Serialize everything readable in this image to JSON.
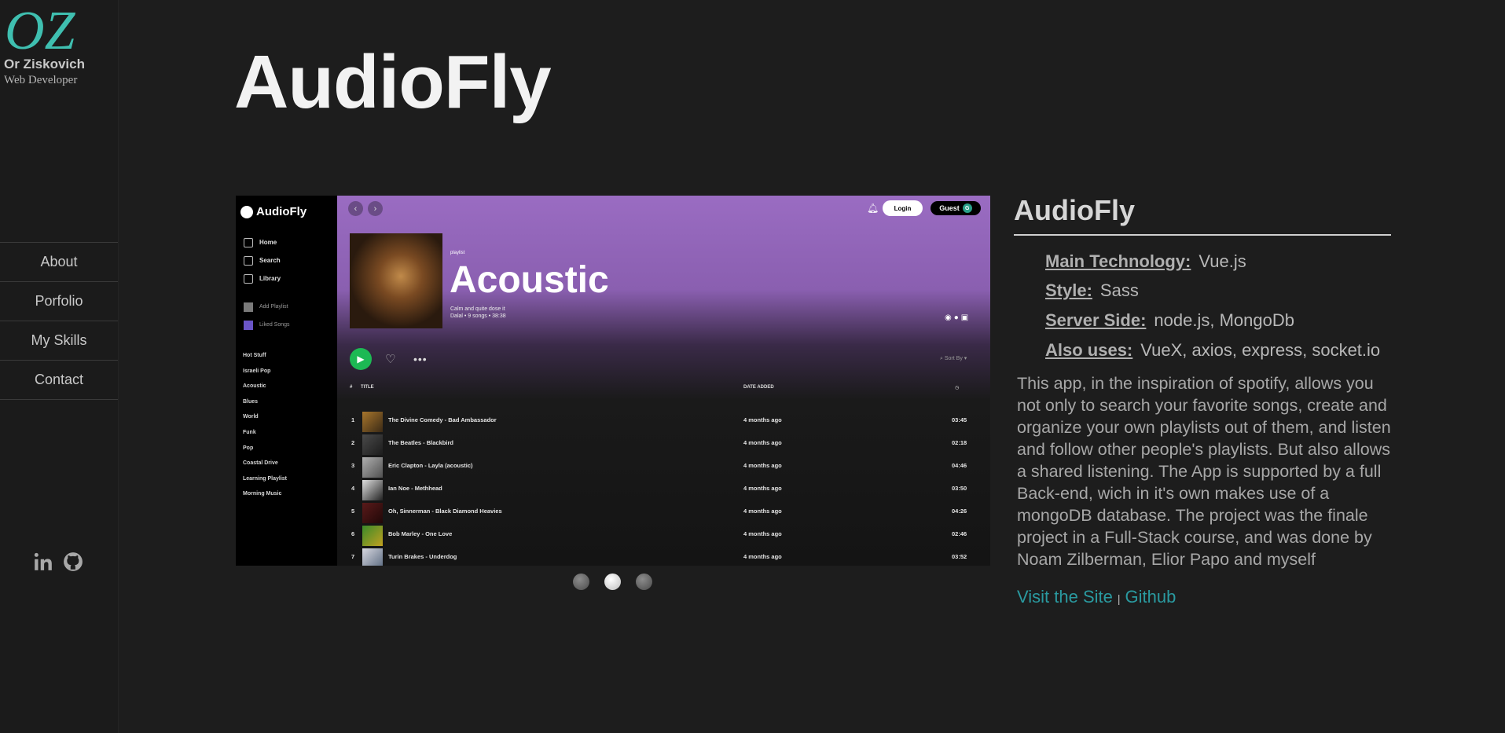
{
  "sidebar": {
    "logo_text": "OZ",
    "name": "Or Ziskovich",
    "role": "Web Developer",
    "nav": [
      {
        "label": "About"
      },
      {
        "label": "Porfolio"
      },
      {
        "label": "My Skills"
      },
      {
        "label": "Contact"
      }
    ],
    "socials": [
      {
        "icon": "linkedin-icon"
      },
      {
        "icon": "github-icon"
      }
    ]
  },
  "main": {
    "title": "AudioFly",
    "carousel": {
      "slide_count": 3,
      "active_index": 1,
      "screenshot": {
        "brand": "AudioFly",
        "nav": [
          "Home",
          "Search",
          "Library"
        ],
        "actions": [
          "Add Playlist",
          "Liked Songs"
        ],
        "playlists": [
          "Hot Stuff",
          "Israeli Pop",
          "Acoustic",
          "Blues",
          "World",
          "Funk",
          "Pop",
          "Coastal Drive",
          "Learning Playlist",
          "Morning Music"
        ],
        "login_label": "Login",
        "guest_label": "Guest",
        "guest_initial": "G",
        "playlist_kind": "playlist",
        "playlist_name": "Acoustic",
        "playlist_desc": "Calm and quite dose it",
        "playlist_meta": "Dalal  •  9 songs  •  38:38",
        "sort_label": "Sort By",
        "col_num": "#",
        "col_title": "TITLE",
        "col_date": "DATE ADDED",
        "songs": [
          {
            "n": "1",
            "title": "The Divine Comedy - Bad Ambassador",
            "added": "4 months ago",
            "dur": "03:45"
          },
          {
            "n": "2",
            "title": "The Beatles - Blackbird",
            "added": "4 months ago",
            "dur": "02:18"
          },
          {
            "n": "3",
            "title": "Eric Clapton - Layla (acoustic)",
            "added": "4 months ago",
            "dur": "04:46"
          },
          {
            "n": "4",
            "title": "Ian Noe - Methhead",
            "added": "4 months ago",
            "dur": "03:50"
          },
          {
            "n": "5",
            "title": "Oh, Sinnerman - Black Diamond Heavies",
            "added": "4 months ago",
            "dur": "04:26"
          },
          {
            "n": "6",
            "title": "Bob Marley - One Love",
            "added": "4 months ago",
            "dur": "02:46"
          },
          {
            "n": "7",
            "title": "Turin Brakes - Underdog",
            "added": "4 months ago",
            "dur": "03:52"
          }
        ]
      }
    }
  },
  "info": {
    "title": "AudioFly",
    "tech": [
      {
        "label": "Main Technology:",
        "value": "Vue.js"
      },
      {
        "label": "Style:",
        "value": "Sass"
      },
      {
        "label": "Server Side:",
        "value": "node.js, MongoDb"
      },
      {
        "label": "Also uses:",
        "value": "VueX, axios, express, socket.io"
      }
    ],
    "description": "This app, in the inspiration of spotify, allows you not only to search your favorite songs, create and organize your own playlists out of them, and listen and follow other people's playlists. But also allows a shared listening. The App is supported by a full Back-end, wich in it's own makes use of a mongoDB database. The project was the finale project in a Full-Stack course, and was done by Noam Zilberman, Elior Papo and myself",
    "links": {
      "site": "Visit the Site",
      "separator": "|",
      "github": "Github"
    }
  },
  "colors": {
    "background": "#1d1d1d",
    "link": "#2a9aa0",
    "logo": "#3fbfb0",
    "play": "#1db954"
  }
}
